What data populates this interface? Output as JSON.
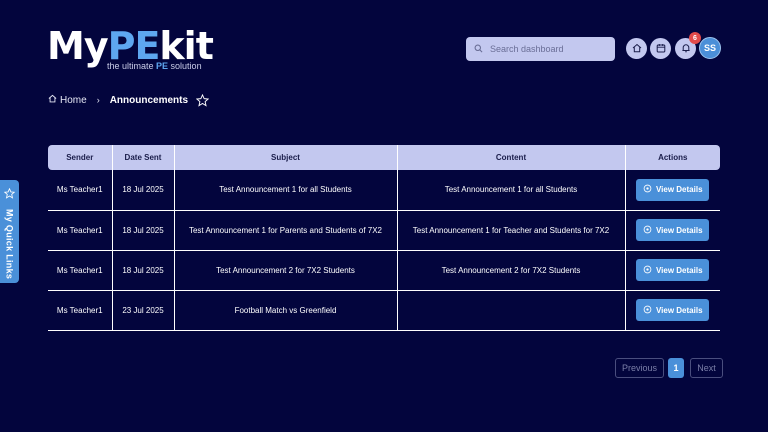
{
  "logo": {
    "text_my": "My",
    "text_pe": "PE",
    "text_kit": "kit",
    "tagline_pre": "the ultimate ",
    "tagline_pe": "PE",
    "tagline_post": " solution"
  },
  "header": {
    "search_placeholder": "Search dashboard",
    "notification_count": "6",
    "avatar_initials": "SS",
    "icons": [
      "home-icon",
      "calendar-icon",
      "bell-icon"
    ]
  },
  "breadcrumb": {
    "home": "Home",
    "separator": "›",
    "current": "Announcements"
  },
  "quick_links": {
    "label": "My Quick Links"
  },
  "table": {
    "columns": [
      "Sender",
      "Date Sent",
      "Subject",
      "Content",
      "Actions"
    ],
    "rows": [
      {
        "sender": "Ms Teacher1",
        "date": "18 Jul 2025",
        "subject": "Test Announcement 1 for all Students",
        "content": "Test Announcement 1 for all Students",
        "action": "View Details"
      },
      {
        "sender": "Ms Teacher1",
        "date": "18 Jul 2025",
        "subject": "Test Announcement 1 for Parents and Students of 7X2",
        "content": "Test Announcement 1 for Teacher and Students for 7X2",
        "action": "View Details"
      },
      {
        "sender": "Ms Teacher1",
        "date": "18 Jul 2025",
        "subject": "Test Announcement 2 for 7X2 Students",
        "content": "Test Announcement 2 for 7X2 Students",
        "action": "View Details"
      },
      {
        "sender": "Ms Teacher1",
        "date": "23 Jul 2025",
        "subject": "Football Match vs Greenfield",
        "content": "",
        "action": "View Details"
      }
    ]
  },
  "pagination": {
    "previous": "Previous",
    "current_page": "1",
    "next": "Next"
  },
  "colors": {
    "background": "#03053d",
    "accent": "#4a90d9",
    "header_row": "#c3c8ef",
    "badge": "#e24b4b"
  }
}
